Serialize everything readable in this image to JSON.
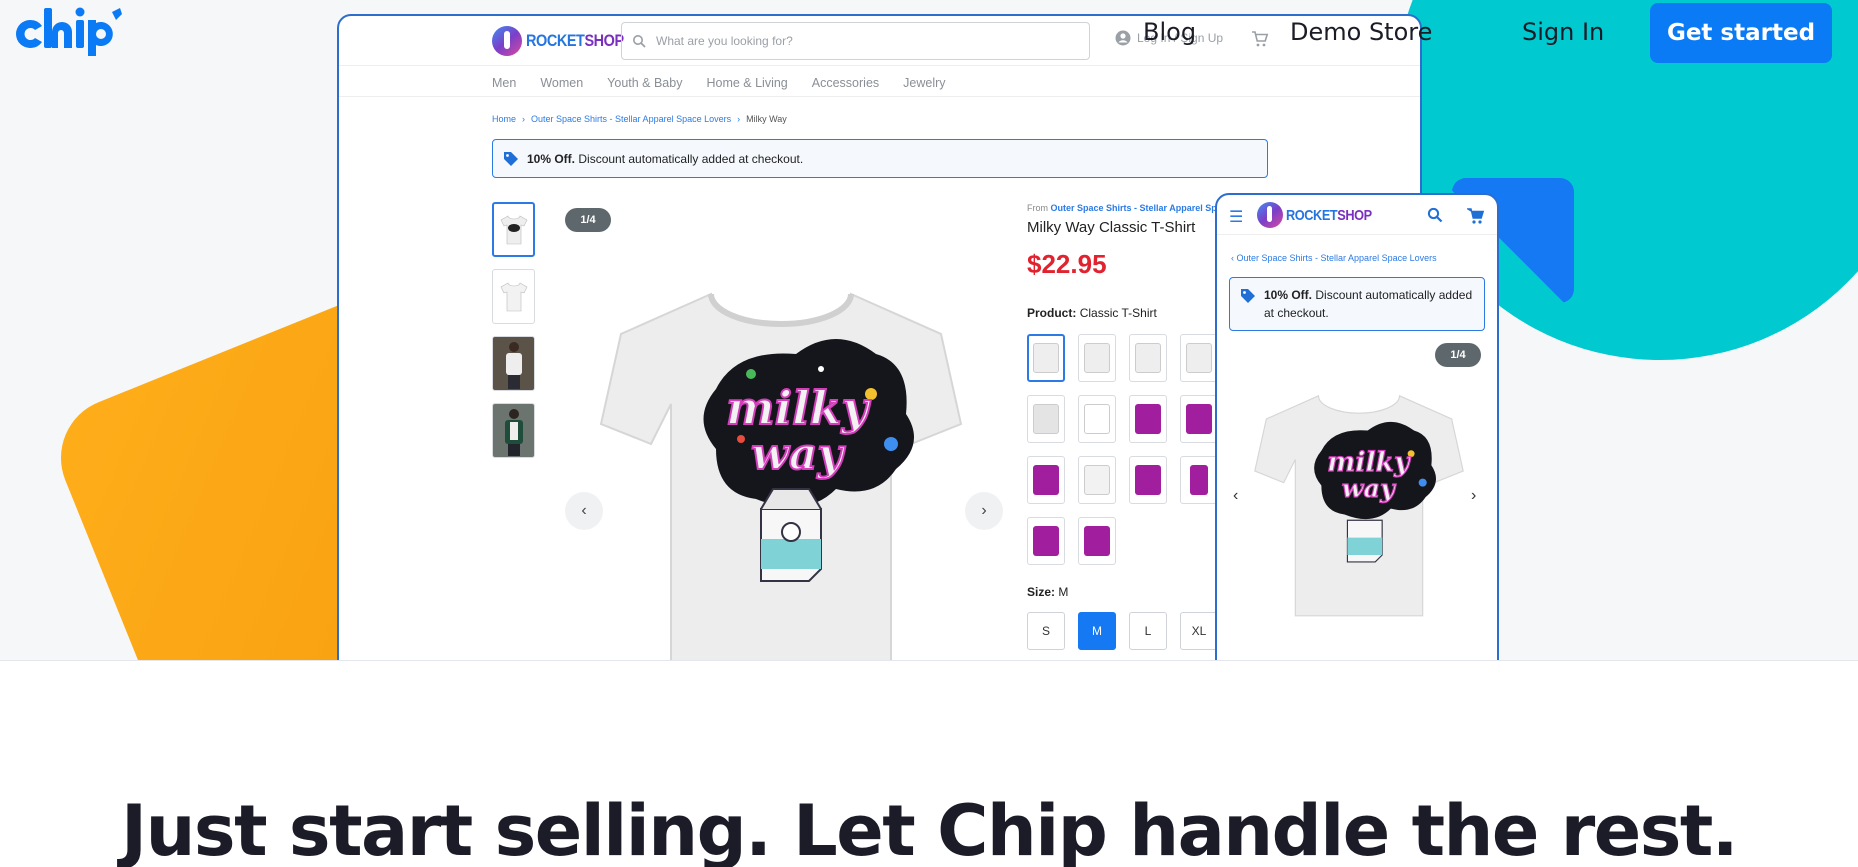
{
  "site": {
    "nav": {
      "blog": "Blog",
      "demo_store": "Demo Store",
      "sign_in": "Sign In",
      "get_started": "Get started"
    },
    "colors": {
      "accent": "#0b7af5",
      "orange": "#ffae1a",
      "teal": "#00c9cf",
      "dark": "#1c1c28"
    },
    "tagline": "Just start selling. Let Chip handle the rest."
  },
  "store": {
    "logo_a": "ROCKET",
    "logo_b": "SHOP",
    "search_placeholder": "What are you looking for?",
    "login": "Log In / Sign Up",
    "categories": [
      "Men",
      "Women",
      "Youth & Baby",
      "Home & Living",
      "Accessories",
      "Jewelry"
    ],
    "breadcrumb": {
      "home": "Home",
      "collection": "Outer Space Shirts - Stellar Apparel Space Lovers",
      "current": "Milky Way"
    },
    "promo_bold": "10% Off.",
    "promo_text": "Discount automatically added at checkout.",
    "pager": "1/4",
    "from_label": "From",
    "from_link": "Outer Space Shirts - Stellar Apparel Spa",
    "title": "Milky Way Classic T-Shirt",
    "price": "$22.95",
    "product_label": "Product:",
    "product_value": "Classic T-Shirt",
    "size_label": "Size:",
    "size_value": "M",
    "sizes": [
      "S",
      "M",
      "L",
      "XL"
    ],
    "selected_size": "M"
  },
  "mobile": {
    "breadcrumb": "Outer Space Shirts - Stellar Apparel Space Lovers",
    "promo_bold": "10% Off.",
    "promo_text": "Discount automatically added at checkout.",
    "pager": "1/4"
  }
}
